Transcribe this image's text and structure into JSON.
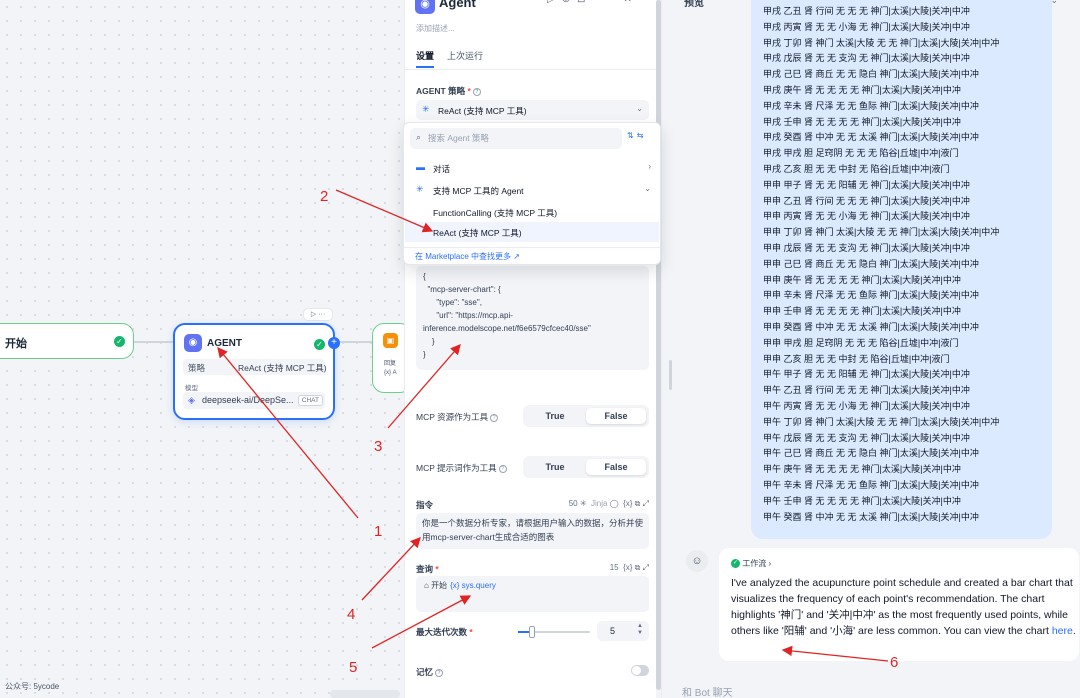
{
  "canvas": {
    "start_node": {
      "label": "开始"
    },
    "agent_node": {
      "title": "AGENT",
      "strategy_key": "策略",
      "strategy_value": "ReAct (支持 MCP 工具)",
      "model_key": "模型",
      "model_value": "deepseek-ai/DeepSe...",
      "model_badge": "CHAT"
    },
    "reply_node": {
      "label_line1": "回复",
      "label_line2": "{x} A"
    },
    "watermark": "公众号: 5ycode"
  },
  "panel": {
    "title": "Agent",
    "description_placeholder": "添加描述...",
    "tabs": [
      "设置",
      "上次运行"
    ],
    "strategy_label": "AGENT 策略",
    "strategy_value": "ReAct (支持 MCP 工具)",
    "dropdown": {
      "search_placeholder": "搜索 Agent 策略",
      "items": [
        "对话",
        "支持 MCP 工具的 Agent",
        "FunctionCalling (支持 MCP 工具)",
        "ReAct (支持 MCP 工具)"
      ],
      "marketplace_link": "在 Marketplace 中查找更多 ↗"
    },
    "mcp_config": "{\n  \"mcp-server-chart\": {\n      \"type\": \"sse\",\n      \"url\": \"https://mcp.api-inference.modelscope.net/f6e6579cfcec40/sse\"\n    }\n}",
    "mcp_resources_label": "MCP 资源作为工具",
    "mcp_prompts_label": "MCP 提示词作为工具",
    "true_label": "True",
    "false_label": "False",
    "instruction_label": "指令",
    "instruction_count": "50",
    "instruction_tools": "Jinja",
    "instruction_text": "你是一个数据分析专家，请根据用户输入的数据，分析并使用mcp-server-chart生成合适的图表",
    "query_label": "查询",
    "query_count": "15",
    "query_chip": "开始",
    "query_var": "{x} sys.query",
    "max_iter_label": "最大迭代次数",
    "max_iter_value": "5",
    "max_iter_ratio": 0.2,
    "memory_label": "记忆"
  },
  "chat": {
    "header": "预览",
    "schedule_lines": [
      "甲戌 乙丑 肾 行间 无 无 无 神门|太溪|大陵|关冲|中冲",
      "甲戌 丙寅 肾 无 无 小海 无 神门|太溪|大陵|关冲|中冲",
      "甲戌 丁卯 肾 神门 太溪|大陵 无 无 神门|太溪|大陵|关冲|中冲",
      "甲戌 戊辰 肾 无 无 支沟 无 神门|太溪|大陵|关冲|中冲",
      "甲戌 己巳 肾 商丘 无 无 隐白 神门|太溪|大陵|关冲|中冲",
      "甲戌 庚午 肾 无 无 无 无 神门|太溪|大陵|关冲|中冲",
      "甲戌 辛未 肾 尺泽 无 无 鱼际 神门|太溪|大陵|关冲|中冲",
      "甲戌 壬申 肾 无 无 无 无 神门|太溪|大陵|关冲|中冲",
      "甲戌 癸酉 肾 中冲 无 无 太溪 神门|太溪|大陵|关冲|中冲",
      "甲戌 甲戌 胆 足窍阴 无 无 无 陷谷|丘墟|中冲|液门",
      "甲戌 乙亥 胆 无 无 中封 无 陷谷|丘墟|中冲|液门",
      "甲申 甲子 肾 无 无 阳辅 无 神门|太溪|大陵|关冲|中冲",
      "甲申 乙丑 肾 行间 无 无 无 神门|太溪|大陵|关冲|中冲",
      "甲申 丙寅 肾 无 无 小海 无 神门|太溪|大陵|关冲|中冲",
      "甲申 丁卯 肾 神门 太溪|大陵 无 无 神门|太溪|大陵|关冲|中冲",
      "甲申 戊辰 肾 无 无 支沟 无 神门|太溪|大陵|关冲|中冲",
      "甲申 己巳 肾 商丘 无 无 隐白 神门|太溪|大陵|关冲|中冲",
      "甲申 庚午 肾 无 无 无 无 神门|太溪|大陵|关冲|中冲",
      "甲申 辛未 肾 尺泽 无 无 鱼际 神门|太溪|大陵|关冲|中冲",
      "甲申 壬申 肾 无 无 无 无 神门|太溪|大陵|关冲|中冲",
      "甲申 癸酉 肾 中冲 无 无 太溪 神门|太溪|大陵|关冲|中冲",
      "甲申 甲戌 胆 足窍阴 无 无 无 陷谷|丘墟|中冲|液门",
      "甲申 乙亥 胆 无 无 中封 无 陷谷|丘墟|中冲|液门",
      "甲午 甲子 肾 无 无 阳辅 无 神门|太溪|大陵|关冲|中冲",
      "甲午 乙丑 肾 行间 无 无 无 神门|太溪|大陵|关冲|中冲",
      "甲午 丙寅 肾 无 无 小海 无 神门|太溪|大陵|关冲|中冲",
      "甲午 丁卯 肾 神门 太溪|大陵 无 无 神门|太溪|大陵|关冲|中冲",
      "甲午 戊辰 肾 无 无 支沟 无 神门|太溪|大陵|关冲|中冲",
      "甲午 己巳 肾 商丘 无 无 隐白 神门|太溪|大陵|关冲|中冲",
      "甲午 庚午 肾 无 无 无 无 神门|太溪|大陵|关冲|中冲",
      "甲午 辛未 肾 尺泽 无 无 鱼际 神门|太溪|大陵|关冲|中冲",
      "甲午 壬申 肾 无 无 无 无 神门|太溪|大陵|关冲|中冲",
      "甲午 癸酉 肾 中冲 无 无 太溪 神门|太溪|大陵|关冲|中冲"
    ],
    "workflow_badge": "工作流",
    "answer_text": "I've analyzed the acupuncture point schedule and created a bar chart that visualizes the frequency of each point's recommendation. The chart highlights '神门' and '关冲|中冲' as the most frequently used points, while others like '阳辅' and '小海' are less common. You can view the chart ",
    "answer_link": "here",
    "input_placeholder": "和 Bot 聊天"
  },
  "annotations": {
    "color": "#e02424",
    "numbers": [
      "1",
      "2",
      "3",
      "4",
      "5",
      "6"
    ]
  }
}
